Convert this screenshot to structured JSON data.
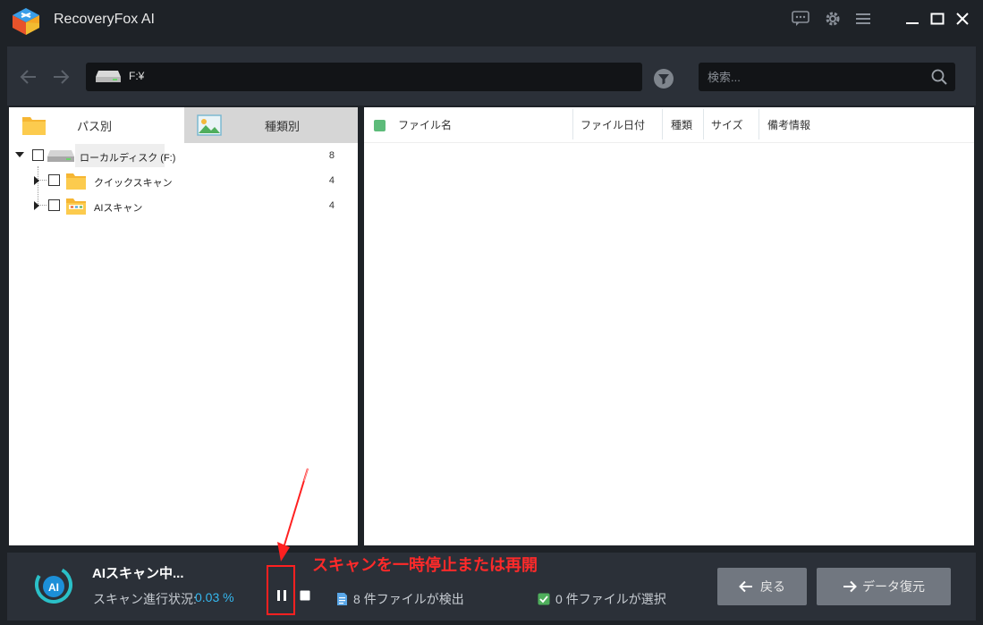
{
  "app": {
    "title": "RecoveryFox AI"
  },
  "nav": {
    "path": "F:¥",
    "search_placeholder": "検索..."
  },
  "tabs": [
    {
      "label": "パス別",
      "active": true
    },
    {
      "label": "種類別",
      "active": false
    }
  ],
  "tree": [
    {
      "label": "ローカルディスク (F:)",
      "count": "8"
    },
    {
      "label": "クイックスキャン",
      "count": "4"
    },
    {
      "label": "AIスキャン",
      "count": "4"
    }
  ],
  "columns": [
    "ファイル名",
    "ファイル日付",
    "種類",
    "サイズ",
    "備考情報"
  ],
  "status": {
    "title": "AIスキャン中...",
    "progress_label": "スキャン進行状況:",
    "progress_value": "0.03 %",
    "found_count": "8",
    "found_label": "件ファイルが検出",
    "selected_count": "0",
    "selected_label": "件ファイルが選択"
  },
  "buttons": {
    "back": "戻る",
    "recover": "データ復元"
  },
  "annotation": {
    "text": "スキャンを一時停止または再開"
  },
  "colors": {
    "background": "#1e2227",
    "panel": "#2b3038",
    "accent": "#35b8f0",
    "button": "#717780",
    "annotation": "#ff2020"
  }
}
